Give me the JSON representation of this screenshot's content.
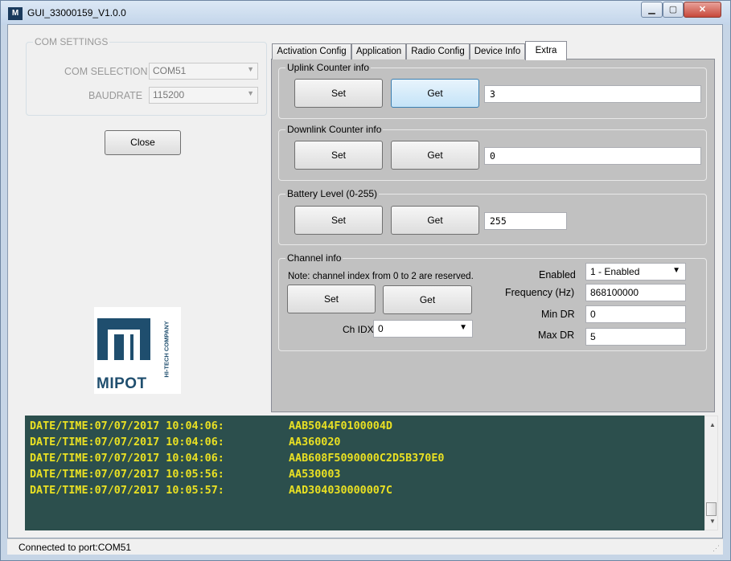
{
  "window": {
    "title": "GUI_33000159_V1.0.0",
    "icon": "app-logo-icon"
  },
  "com_settings": {
    "legend": "COM SETTINGS",
    "com_selection_label": "COM SELECTION",
    "com_selection_value": "COM51",
    "baudrate_label": "BAUDRATE",
    "baudrate_value": "115200",
    "close_label": "Close"
  },
  "logo": {
    "name": "MIPOT",
    "tagline": "HI-TECH COMPANY"
  },
  "tabs": [
    {
      "label": "Activation Config",
      "active": false
    },
    {
      "label": "Application",
      "active": false
    },
    {
      "label": "Radio Config",
      "active": false
    },
    {
      "label": "Device Info",
      "active": false
    },
    {
      "label": "Extra",
      "active": true
    }
  ],
  "uplink": {
    "legend": "Uplink Counter info",
    "set": "Set",
    "get": "Get",
    "value": "3"
  },
  "downlink": {
    "legend": "Downlink Counter info",
    "set": "Set",
    "get": "Get",
    "value": "0"
  },
  "battery": {
    "legend": "Battery Level (0-255)",
    "set": "Set",
    "get": "Get",
    "value": "255"
  },
  "channel": {
    "legend": "Channel info",
    "note": "Note: channel index from 0 to 2 are reserved.",
    "set": "Set",
    "get": "Get",
    "ch_idx_label": "Ch IDX",
    "ch_idx_value": "0",
    "enabled_label": "Enabled",
    "enabled_value": "1 - Enabled",
    "frequency_label": "Frequency (Hz)",
    "frequency_value": "868100000",
    "min_dr_label": "Min DR",
    "min_dr_value": "0",
    "max_dr_label": "Max DR",
    "max_dr_value": "5"
  },
  "log": [
    {
      "ts": "DATE/TIME:07/07/2017 10:04:06:",
      "msg": "AAB5044F0100004D"
    },
    {
      "ts": "DATE/TIME:07/07/2017 10:04:06:",
      "msg": "AA360020"
    },
    {
      "ts": "DATE/TIME:07/07/2017 10:04:06:",
      "msg": "AAB608F5090000C2D5B370E0"
    },
    {
      "ts": "DATE/TIME:07/07/2017 10:05:56:",
      "msg": "AA530003"
    },
    {
      "ts": "DATE/TIME:07/07/2017 10:05:57:",
      "msg": "AAD304030000007C"
    }
  ],
  "status": {
    "text": "Connected to port:COM51"
  },
  "colors": {
    "log_bg": "#2c4f4d",
    "log_text": "#e9e023",
    "panel_bg": "#c1c1c1",
    "logo_blue": "#1f4e6e"
  }
}
